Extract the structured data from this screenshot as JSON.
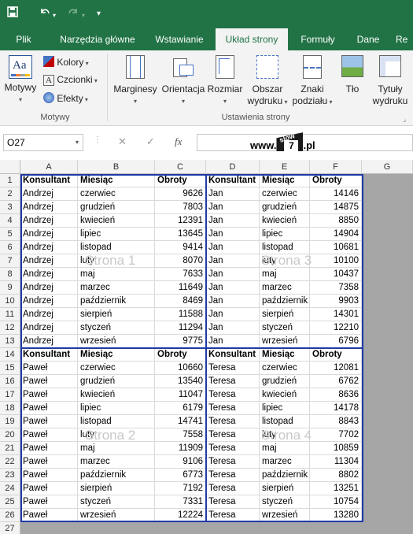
{
  "quick_access": {
    "save": "save-icon",
    "undo": "undo-icon",
    "redo": "redo-icon",
    "customize": "▾"
  },
  "tabs": [
    "Plik",
    "Narzędzia główne",
    "Wstawianie",
    "Układ strony",
    "Formuły",
    "Dane",
    "Re"
  ],
  "ribbon": {
    "motywy_group": {
      "themes": "Motywy",
      "colors": "Kolory",
      "fonts": "Czcionki",
      "effects": "Efekty",
      "label": "Motywy"
    },
    "page_setup_group": {
      "margins": "Marginesy",
      "orientation": "Orientacja",
      "size": "Rozmiar",
      "print_area_1": "Obszar",
      "print_area_2": "wydruku",
      "breaks_1": "Znaki",
      "breaks_2": "podziału",
      "background": "Tło",
      "titles_1": "Tytuły",
      "titles_2": "wydruku",
      "label": "Ustawienia strony"
    }
  },
  "formula_bar": {
    "name_box": "O27",
    "fx": "fx",
    "watermark_pre": "www.",
    "watermark_slow": "slow",
    "watermark_num": "7",
    "watermark_post": ".pl"
  },
  "columns": [
    "A",
    "B",
    "C",
    "D",
    "E",
    "F",
    "G"
  ],
  "rows": [
    "1",
    "2",
    "3",
    "4",
    "5",
    "6",
    "7",
    "8",
    "9",
    "10",
    "11",
    "12",
    "13",
    "14",
    "15",
    "16",
    "17",
    "18",
    "19",
    "20",
    "21",
    "22",
    "23",
    "24",
    "25",
    "26",
    "27"
  ],
  "headers": {
    "k": "Konsultant",
    "m": "Miesiąc",
    "o": "Obroty"
  },
  "page_labels": {
    "p1": "Strona 1",
    "p2": "Strona 2",
    "p3": "Strona 3",
    "p4": "Strona 4"
  },
  "block1": [
    [
      "Andrzej",
      "czerwiec",
      "9626",
      "Jan",
      "czerwiec",
      "14146"
    ],
    [
      "Andrzej",
      "grudzień",
      "7803",
      "Jan",
      "grudzień",
      "14875"
    ],
    [
      "Andrzej",
      "kwiecień",
      "12391",
      "Jan",
      "kwiecień",
      "8850"
    ],
    [
      "Andrzej",
      "lipiec",
      "13645",
      "Jan",
      "lipiec",
      "14904"
    ],
    [
      "Andrzej",
      "listopad",
      "9414",
      "Jan",
      "listopad",
      "10681"
    ],
    [
      "Andrzej",
      "luty",
      "8070",
      "Jan",
      "luty",
      "10100"
    ],
    [
      "Andrzej",
      "maj",
      "7633",
      "Jan",
      "maj",
      "10437"
    ],
    [
      "Andrzej",
      "marzec",
      "11649",
      "Jan",
      "marzec",
      "7358"
    ],
    [
      "Andrzej",
      "październik",
      "8469",
      "Jan",
      "październik",
      "9903"
    ],
    [
      "Andrzej",
      "sierpień",
      "11588",
      "Jan",
      "sierpień",
      "14301"
    ],
    [
      "Andrzej",
      "styczeń",
      "11294",
      "Jan",
      "styczeń",
      "12210"
    ],
    [
      "Andrzej",
      "wrzesień",
      "9775",
      "Jan",
      "wrzesień",
      "6796"
    ]
  ],
  "block2": [
    [
      "Paweł",
      "czerwiec",
      "10660",
      "Teresa",
      "czerwiec",
      "12081"
    ],
    [
      "Paweł",
      "grudzień",
      "13540",
      "Teresa",
      "grudzień",
      "6762"
    ],
    [
      "Paweł",
      "kwiecień",
      "11047",
      "Teresa",
      "kwiecień",
      "8636"
    ],
    [
      "Paweł",
      "lipiec",
      "6179",
      "Teresa",
      "lipiec",
      "14178"
    ],
    [
      "Paweł",
      "listopad",
      "14741",
      "Teresa",
      "listopad",
      "8843"
    ],
    [
      "Paweł",
      "luty",
      "7558",
      "Teresa",
      "luty",
      "7702"
    ],
    [
      "Paweł",
      "maj",
      "11909",
      "Teresa",
      "maj",
      "10859"
    ],
    [
      "Paweł",
      "marzec",
      "9106",
      "Teresa",
      "marzec",
      "11304"
    ],
    [
      "Paweł",
      "październik",
      "6773",
      "Teresa",
      "październik",
      "8802"
    ],
    [
      "Paweł",
      "sierpień",
      "7192",
      "Teresa",
      "sierpień",
      "13251"
    ],
    [
      "Paweł",
      "styczeń",
      "7331",
      "Teresa",
      "styczeń",
      "10754"
    ],
    [
      "Paweł",
      "wrzesień",
      "12224",
      "Teresa",
      "wrzesień",
      "13280"
    ]
  ],
  "colors": {
    "excel_green": "#217346",
    "page_break": "#1f3aa6",
    "grid_gray": "#a6a6a6"
  }
}
